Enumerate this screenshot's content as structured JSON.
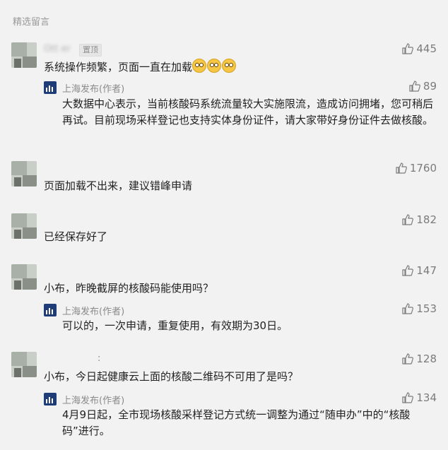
{
  "section_title": "精选留言",
  "comments": [
    {
      "nickname": "Ott er",
      "pinned_label": "置顶",
      "likes": "445",
      "text": "系统操作频繁，页面一直在加载",
      "emoji": "flushed-face-emoji x3",
      "reply": {
        "author": "上海发布(作者)",
        "likes": "89",
        "text": "大数据中心表示，当前核酸码系统流量较大实施限流，造成访问拥堵，您可稍后再试。目前现场采样登记也支持实体身份证件，请大家带好身份证件去做核酸。"
      }
    },
    {
      "nickname": "",
      "likes": "1760",
      "text": "页面加载不出来，建议错峰申请"
    },
    {
      "nickname": "",
      "likes": "182",
      "text": "已经保存好了"
    },
    {
      "nickname": "",
      "likes": "147",
      "text": "小布，昨晚截屏的核酸码能使用吗？",
      "reply": {
        "author": "上海发布(作者)",
        "likes": "153",
        "text": "可以的，一次申请，重复使用，有效期为30日。"
      }
    },
    {
      "nickname": ":",
      "likes": "128",
      "text": "小布，今日起健康云上面的核酸二维码不可用了是吗？",
      "reply": {
        "author": "上海发布(作者)",
        "likes": "134",
        "text": "4月9日起，全市现场核酸采样登记方式统一调整为通过“随申办”中的“核酸码”进行。"
      }
    }
  ]
}
